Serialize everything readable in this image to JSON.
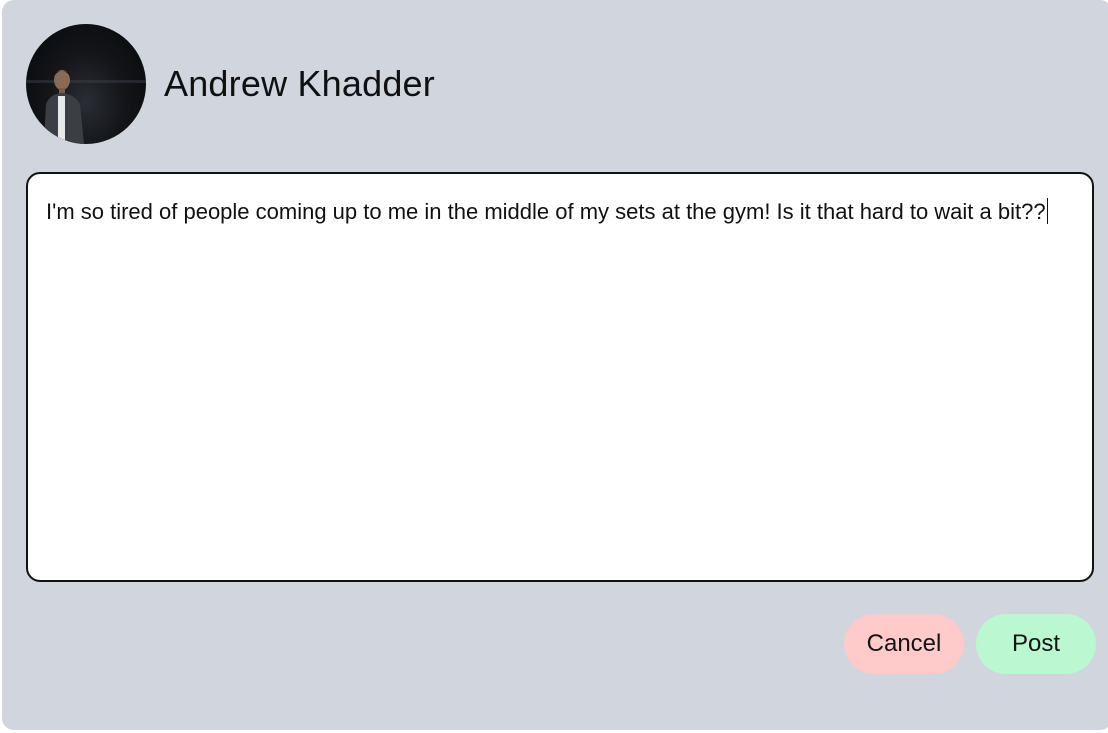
{
  "user": {
    "name": "Andrew Khadder",
    "avatar_icon": "user-photo-avatar"
  },
  "composer": {
    "value": "I'm so tired of people coming up to me in the middle of my sets at the gym! Is it that hard to wait a bit??"
  },
  "actions": {
    "cancel_label": "Cancel",
    "post_label": "Post"
  },
  "colors": {
    "card_background": "#d1d5dd",
    "cancel_button": "#fecaca",
    "post_button": "#bbf7d0",
    "border": "#111111"
  }
}
